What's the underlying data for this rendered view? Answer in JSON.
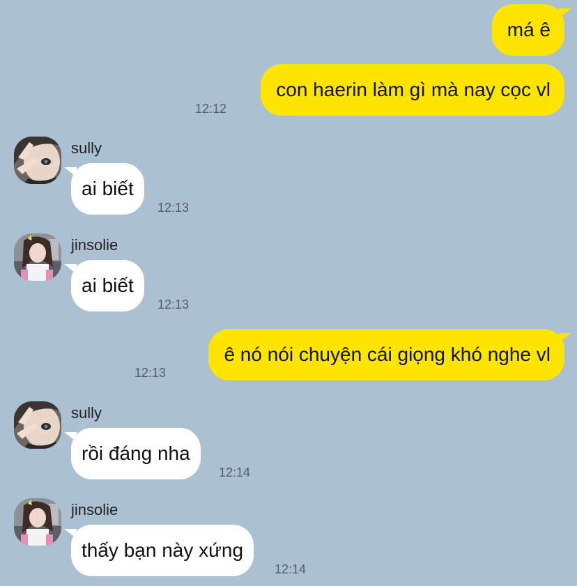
{
  "colors": {
    "background": "#abc0d2",
    "my_bubble": "#fee500",
    "their_bubble": "#ffffff",
    "timestamp": "#555e6a"
  },
  "messages": [
    {
      "id": "m1",
      "sender": "me",
      "text": "má ê",
      "time": ""
    },
    {
      "id": "m2",
      "sender": "me",
      "text": "con haerin làm gì mà nay cọc vl",
      "time": "12:12"
    },
    {
      "id": "m3",
      "sender": "sully",
      "name": "sully",
      "text": "ai biết",
      "time": "12:13",
      "avatar_icon": "avatar-peace-sign"
    },
    {
      "id": "m4",
      "sender": "jinsolie",
      "name": "jinsolie",
      "text": "ai biết",
      "time": "12:13",
      "avatar_icon": "avatar-girl-street"
    },
    {
      "id": "m5",
      "sender": "me",
      "text": "ê nó nói chuyện cái giọng khó nghe vl",
      "time": "12:13"
    },
    {
      "id": "m6",
      "sender": "sully",
      "name": "sully",
      "text": "rồi đáng nha",
      "time": "12:14",
      "avatar_icon": "avatar-peace-sign"
    },
    {
      "id": "m7",
      "sender": "jinsolie",
      "name": "jinsolie",
      "text": "thấy bạn này xứng",
      "time": "12:14",
      "avatar_icon": "avatar-girl-street"
    }
  ]
}
